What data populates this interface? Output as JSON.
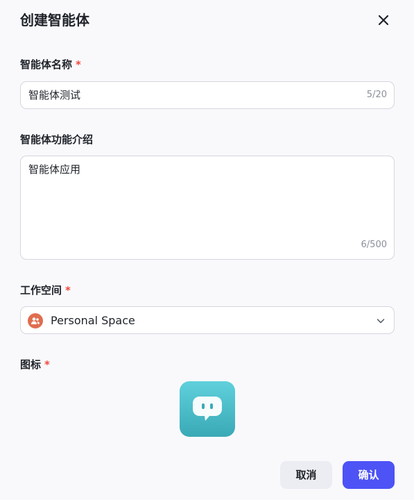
{
  "dialog": {
    "title": "创建智能体",
    "close_icon": "close-icon"
  },
  "name_field": {
    "label": "智能体名称",
    "required_mark": "*",
    "value": "智能体测试",
    "counter": "5/20"
  },
  "description_field": {
    "label": "智能体功能介绍",
    "value": "智能体应用",
    "counter": "6/500"
  },
  "workspace_field": {
    "label": "工作空间",
    "required_mark": "*",
    "selected": "Personal Space",
    "avatar_icon": "users-icon",
    "avatar_color": "#e06d4f"
  },
  "icon_field": {
    "label": "图标",
    "required_mark": "*",
    "icon": "chat-bubble-icon",
    "icon_color": "#4bbcc8"
  },
  "actions": {
    "cancel_label": "取消",
    "confirm_label": "确认",
    "confirm_color": "#4d53f5"
  }
}
